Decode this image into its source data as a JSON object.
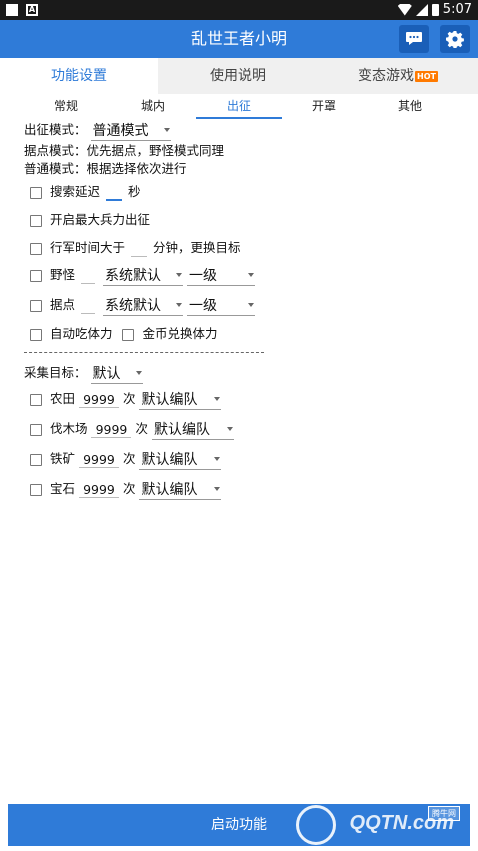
{
  "status_bar": {
    "time": "5:07"
  },
  "app": {
    "title": "乱世王者小明"
  },
  "main_tabs": [
    {
      "label": "功能设置"
    },
    {
      "label": "使用说明"
    },
    {
      "label": "变态游戏",
      "badge": "HOT"
    }
  ],
  "sub_tabs": [
    {
      "label": "常规"
    },
    {
      "label": "城内"
    },
    {
      "label": "出征"
    },
    {
      "label": "开罩"
    },
    {
      "label": "其他"
    }
  ],
  "expedition": {
    "mode_label": "出征模式：",
    "mode_value": "普通模式",
    "desc_outpost": "据点模式：优先据点，野怪模式同理",
    "desc_normal": "普通模式：根据选择依次进行",
    "search_delay_label": "搜索延迟",
    "search_delay_value": "",
    "search_delay_unit": "秒",
    "max_troops_label": "开启最大兵力出征",
    "march_time_label": "行军时间大于",
    "march_time_value": "",
    "march_time_suffix": "分钟，更换目标",
    "monster_label": "野怪",
    "monster_value": "",
    "monster_select": "系统默认",
    "monster_level": "一级",
    "outpost_label": "据点",
    "outpost_value": "",
    "outpost_select": "系统默认",
    "outpost_level": "一级",
    "auto_stamina_label": "自动吃体力",
    "coin_stamina_label": "金币兑换体力"
  },
  "gather": {
    "target_label": "采集目标：",
    "target_value": "默认",
    "times_unit": "次",
    "items": [
      {
        "label": "农田",
        "count": "9999",
        "team": "默认编队"
      },
      {
        "label": "伐木场",
        "count": "9999",
        "team": "默认编队"
      },
      {
        "label": "铁矿",
        "count": "9999",
        "team": "默认编队"
      },
      {
        "label": "宝石",
        "count": "9999",
        "team": "默认编队"
      }
    ]
  },
  "bottom": {
    "start_label": "启动功能",
    "watermark": "QQTN.com",
    "watermark_tag": "腾牛网"
  },
  "colors": {
    "primary": "#2f7bd8",
    "hot": "#ff7a00"
  }
}
